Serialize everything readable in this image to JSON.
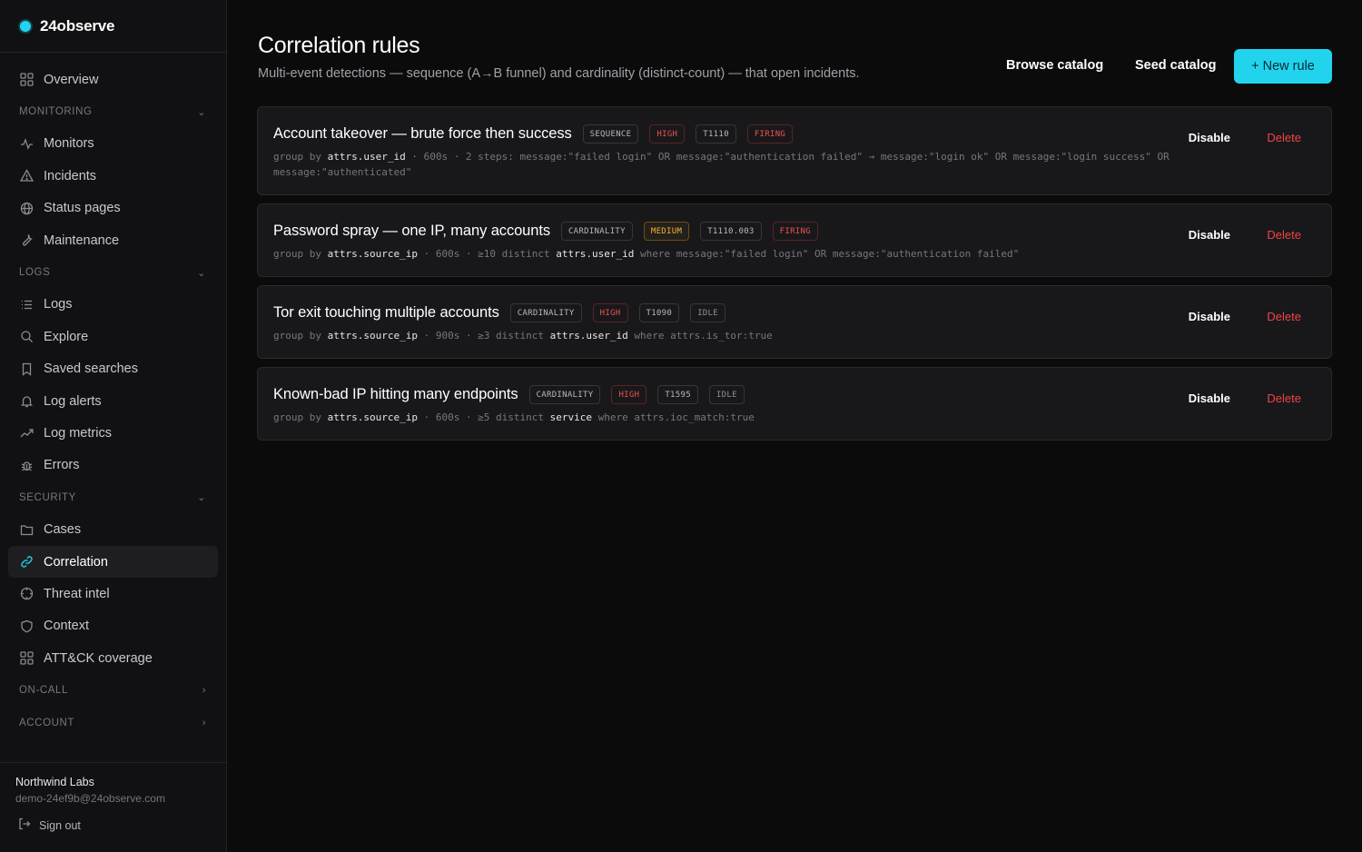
{
  "brand": {
    "name": "24observe",
    "accent": "#22d3ee"
  },
  "nav": {
    "overview": "Overview",
    "monitoring": {
      "label": "MONITORING",
      "items": [
        "Monitors",
        "Incidents",
        "Status pages",
        "Maintenance"
      ]
    },
    "logs": {
      "label": "LOGS",
      "items": [
        "Logs",
        "Explore",
        "Saved searches",
        "Log alerts",
        "Log metrics",
        "Errors"
      ]
    },
    "security": {
      "label": "SECURITY",
      "items": [
        "Cases",
        "Correlation",
        "Threat intel",
        "Context",
        "ATT&CK coverage"
      ]
    },
    "oncall": {
      "label": "ON-CALL"
    },
    "account": {
      "label": "ACCOUNT"
    }
  },
  "footer": {
    "org": "Northwind Labs",
    "email": "demo-24ef9b@24observe.com",
    "signout": "Sign out"
  },
  "header": {
    "title": "Correlation rules",
    "subtitle": "Multi-event detections — sequence (A→B funnel) and cardinality (distinct-count) — that open incidents.",
    "browse": "Browse catalog",
    "seed": "Seed catalog",
    "new_rule": "+ New rule"
  },
  "rules": [
    {
      "title": "Account takeover — brute force then success",
      "type": "SEQUENCE",
      "severity": "HIGH",
      "technique": "T1110",
      "state": "FIRING",
      "desc": {
        "p1": "group by ",
        "field": "attrs.user_id",
        "p2": " · 600s · 2 steps: message:\"failed login\" OR message:\"authentication failed\" → message:\"login ok\" OR message:\"login success\" OR message:\"authenticated\""
      },
      "disable": "Disable",
      "delete": "Delete"
    },
    {
      "title": "Password spray — one IP, many accounts",
      "type": "CARDINALITY",
      "severity": "MEDIUM",
      "technique": "T1110.003",
      "state": "FIRING",
      "desc": {
        "p1": "group by ",
        "field": "attrs.source_ip",
        "p2": " · 600s · ≥10 distinct ",
        "field2": "attrs.user_id",
        "p3": " where message:\"failed login\" OR message:\"authentication failed\""
      },
      "disable": "Disable",
      "delete": "Delete"
    },
    {
      "title": "Tor exit touching multiple accounts",
      "type": "CARDINALITY",
      "severity": "HIGH",
      "technique": "T1090",
      "state": "IDLE",
      "desc": {
        "p1": "group by ",
        "field": "attrs.source_ip",
        "p2": " · 900s · ≥3 distinct ",
        "field2": "attrs.user_id",
        "p3": " where attrs.is_tor:true"
      },
      "disable": "Disable",
      "delete": "Delete"
    },
    {
      "title": "Known-bad IP hitting many endpoints",
      "type": "CARDINALITY",
      "severity": "HIGH",
      "technique": "T1595",
      "state": "IDLE",
      "desc": {
        "p1": "group by ",
        "field": "attrs.source_ip",
        "p2": " · 600s · ≥5 distinct ",
        "field2": "service",
        "p3": " where attrs.ioc_match:true"
      },
      "disable": "Disable",
      "delete": "Delete"
    }
  ]
}
